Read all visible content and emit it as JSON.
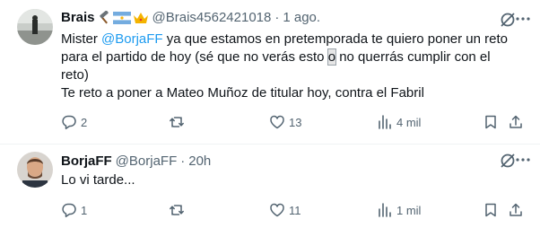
{
  "tweets": [
    {
      "name": "Brais",
      "handle": "@Brais4562421018",
      "dot": "·",
      "time": "1 ago.",
      "text_lines": {
        "l1_pre": "Mister ",
        "l1_mention": "@BorjaFF",
        "l1_post": " ya que estamos en pretemporada te quiero poner un reto",
        "l2": "para el partido de hoy (sé que no verás esto ",
        "l2_o": "o",
        "l2_post": " no querrás cumplir con el",
        "l3": "reto)",
        "l4": "Te reto a poner a Mateo Muñoz de titular hoy, contra el Fabril"
      },
      "counts": {
        "replies": "2",
        "retweets": "",
        "likes": "13",
        "views": "4 mil"
      }
    },
    {
      "name": "BorjaFF",
      "handle": "@BorjaFF",
      "dot": "·",
      "time": "20h",
      "text": "Lo vi tarde...",
      "counts": {
        "replies": "1",
        "retweets": "",
        "likes": "11",
        "views": "1 mil"
      }
    }
  ],
  "colors": {
    "accent": "#1d9bf0",
    "secondary": "#536471",
    "text": "#0f1419"
  },
  "icons": [
    "grok-icon",
    "more-icon",
    "reply-icon",
    "retweet-icon",
    "like-icon",
    "views-icon",
    "bookmark-icon",
    "share-icon",
    "hammer-icon",
    "argentina-flag-icon",
    "crown-icon"
  ]
}
